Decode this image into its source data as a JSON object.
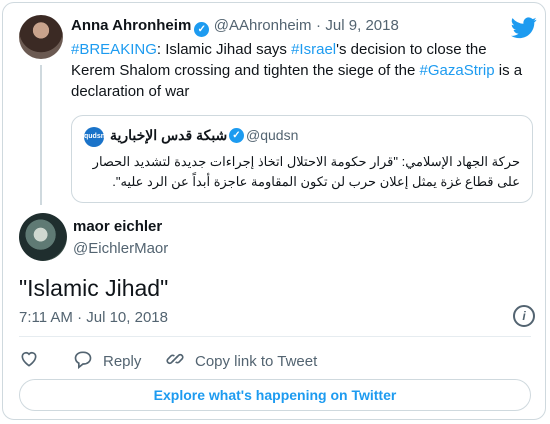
{
  "original_tweet": {
    "author_name": "Anna Ahronheim",
    "author_handle": "@AAhronheim",
    "separator": "·",
    "date": "Jul 9, 2018",
    "text_parts": {
      "breaking": "#BREAKING",
      "t1": ": Islamic Jihad says ",
      "israel": "#Israel",
      "t2": "'s decision to close the Kerem Shalom crossing and tighten the siege of the ",
      "gaza": "#GazaStrip",
      "t3": " is a declaration of war"
    }
  },
  "quoted_tweet": {
    "logo_text": "qudsn",
    "author_name": "شبكة قدس الإخبارية",
    "author_handle": "@qudsn",
    "text": "حركة الجهاد الإسلامي: \"قرار حكومة الاحتلال اتخاذ إجراءات جديدة لتشديد الحصار على قطاع غزة يمثل إعلان حرب لن تكون المقاومة عاجزة أبداً عن الرد عليه\"."
  },
  "reply_tweet": {
    "author_name": "maor eichler",
    "author_handle": "@EichlerMaor",
    "text": "\"Islamic Jihad\"",
    "timestamp": "7:11 AM · Jul 10, 2018"
  },
  "actions": {
    "reply_label": "Reply",
    "copy_link_label": "Copy link to Tweet"
  },
  "explore_button": "Explore what's happening on Twitter",
  "colors": {
    "link": "#1d9bf0",
    "text": "#0f1419",
    "muted": "#536471",
    "heart": "#536471"
  },
  "icons": [
    "twitter-bird-icon",
    "verified-badge-icon",
    "info-icon",
    "heart-icon",
    "reply-icon",
    "copy-link-icon"
  ]
}
